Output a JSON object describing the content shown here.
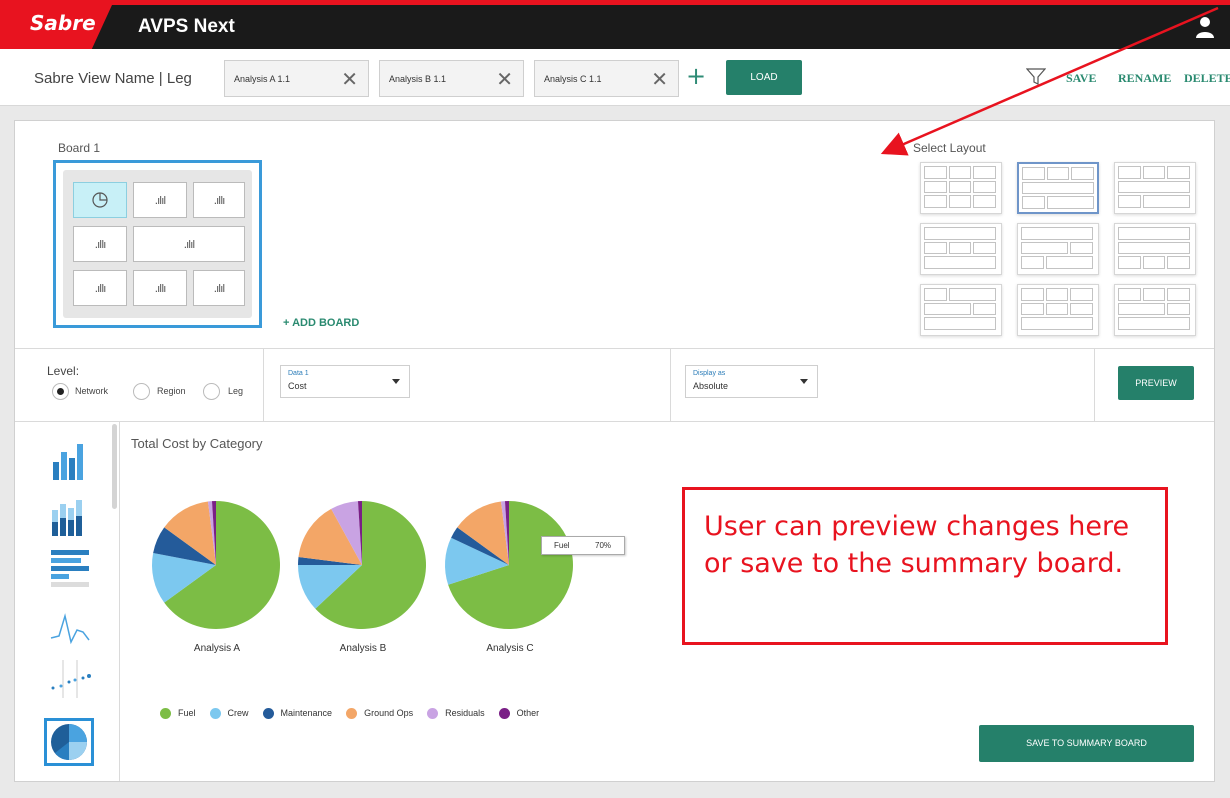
{
  "app": {
    "brand": "Sabre",
    "title": "AVPS Next"
  },
  "toolbar": {
    "view_name": "Sabre View Name | Leg",
    "tabs": [
      {
        "label": "Analysis A 1.1"
      },
      {
        "label": "Analysis B 1.1"
      },
      {
        "label": "Analysis C 1.1"
      }
    ],
    "load_label": "LOAD",
    "actions": {
      "save": "SAVE",
      "rename": "RENAME",
      "delete": "DELETE"
    }
  },
  "board": {
    "label": "Board 1",
    "add_board": "+ ADD BOARD",
    "select_layout": "Select Layout"
  },
  "controls": {
    "level_label": "Level:",
    "levels": [
      "Network",
      "Region",
      "Leg"
    ],
    "selected_level": "Network",
    "data": {
      "caption": "Data 1",
      "value": "Cost"
    },
    "display": {
      "caption": "Display as",
      "value": "Absolute"
    },
    "preview_label": "PREVIEW"
  },
  "chart": {
    "title": "Total Cost by Category",
    "tooltip": {
      "key": "Fuel",
      "value": "70%"
    },
    "save_label": "SAVE TO SUMMARY BOARD"
  },
  "colors": {
    "fuel": "#7cbd45",
    "crew": "#7cc8ef",
    "maintenance": "#245b9a",
    "ground_ops": "#f3a667",
    "residuals": "#c9a3e3",
    "other": "#7a1f86",
    "accent": "#25806a",
    "brand_red": "#e8131f"
  },
  "chart_data": {
    "type": "pie",
    "title": "Total Cost by Category",
    "categories": [
      "Fuel",
      "Crew",
      "Maintenance",
      "Ground Ops",
      "Residuals",
      "Other"
    ],
    "series": [
      {
        "name": "Analysis A",
        "values": [
          65,
          13,
          7,
          13,
          1,
          1
        ]
      },
      {
        "name": "Analysis B",
        "values": [
          63,
          12,
          2,
          15,
          7,
          1
        ]
      },
      {
        "name": "Analysis C",
        "values": [
          70,
          12,
          3,
          13,
          1,
          1
        ]
      }
    ]
  },
  "annotation": {
    "text": "User can preview changes here or save to the summary board."
  }
}
